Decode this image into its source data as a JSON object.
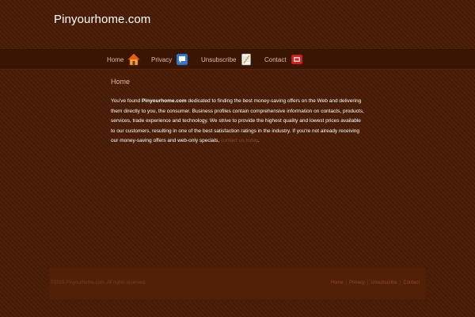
{
  "header": {
    "site_title": "Pinyourhome.com"
  },
  "nav": [
    {
      "label": "Home",
      "icon": "house-icon"
    },
    {
      "label": "Privacy",
      "icon": "speech-bubble-icon"
    },
    {
      "label": "Unsubscribe",
      "icon": "notepad-icon"
    },
    {
      "label": "Contact",
      "icon": "telephone-icon"
    }
  ],
  "main": {
    "title": "Home",
    "intro": "You've found ",
    "brand": "Pinyourhome.com",
    "text": " dedicated to finding the best money-saving offers on the Web and delivering them directly to you, the consumer. Business profiles contain comprehensive information on contacts, products, services, trade experience and technology. We strive to provide the highest quality and lowest prices available to our customers, resulting in one of the best satisfaction ratings in the industry. If you're not already receiving our money-saving offers and web-only specials, ",
    "link_text": "contact us today",
    "ending": "."
  },
  "footer": {
    "copyright": "©2015 Pinyourhome.com. All rights reserved.",
    "links": [
      "Home",
      "Privacy",
      "Unsubscribe",
      "Contact"
    ],
    "separator": "|"
  },
  "colors": {
    "background": "#4a1c06",
    "navbar": "#3a1504",
    "footer_panel": "#521f07",
    "nav_text": "#e5b9a0",
    "link": "#8a4a2a"
  }
}
